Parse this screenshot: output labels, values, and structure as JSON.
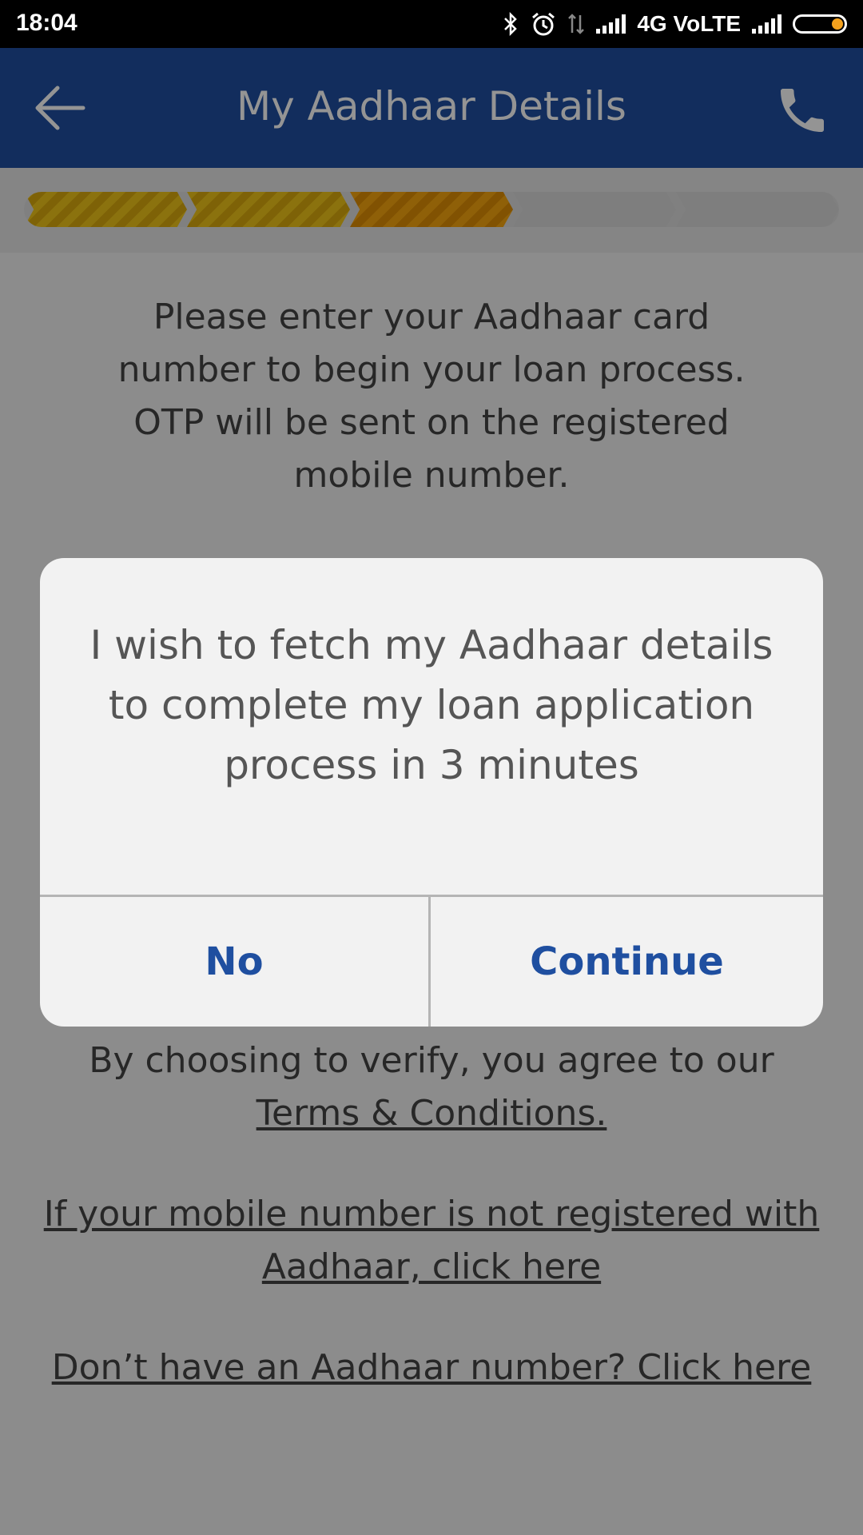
{
  "status_bar": {
    "time": "18:04",
    "network": "4G VoLTE"
  },
  "app_bar": {
    "title": "My Aadhaar Details",
    "back_icon": "arrow-left-icon",
    "phone_icon": "phone-icon"
  },
  "progress": {
    "steps_total": 5,
    "steps_completed": 2,
    "current_step": 3
  },
  "content": {
    "intro_text": "Please enter your Aadhaar card number to begin your loan process. OTP will be sent on the registered mobile number.",
    "terms_prefix": "By choosing to verify, you agree to our",
    "terms_link": "Terms & Conditions.",
    "mobile_not_registered_link": "If your mobile number is not registered with Aadhaar, click here",
    "no_aadhaar_link": "Don’t have an Aadhaar number? Click here"
  },
  "dialog": {
    "message": "I wish to fetch my Aadhaar details to complete my loan application process in 3 minutes",
    "no_label": "No",
    "continue_label": "Continue"
  },
  "colors": {
    "app_bar": "#1f4fa0",
    "accent_button_text": "#1f4fa0",
    "progress_done": "#f0c419",
    "progress_current": "#f6a50f"
  }
}
